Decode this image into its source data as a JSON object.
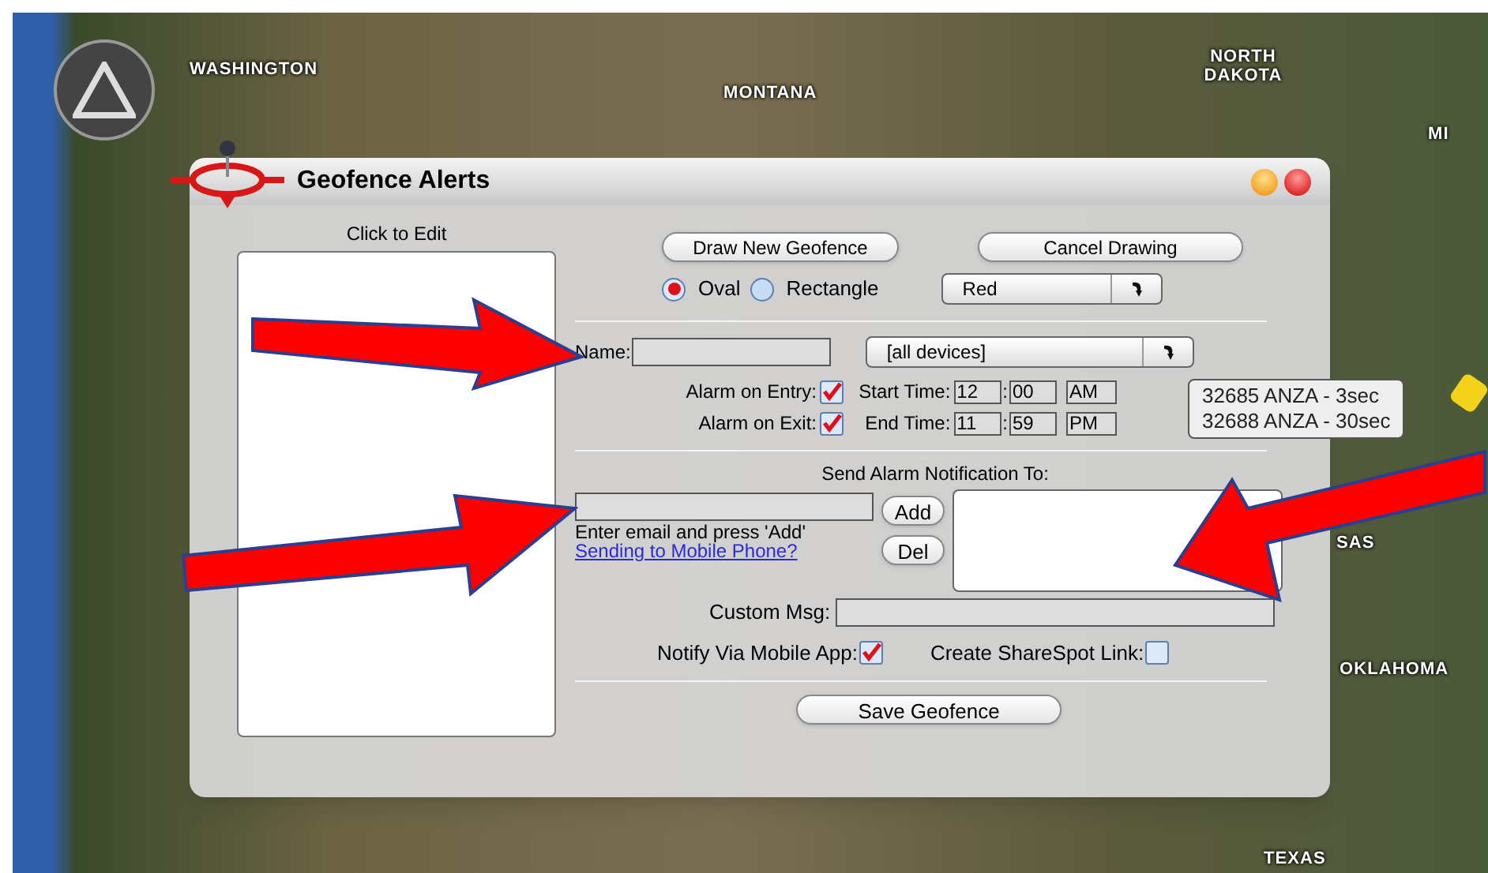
{
  "map": {
    "labels": [
      "WASHINGTON",
      "MONTANA",
      "NORTH DAKOTA",
      "MI",
      "SAS",
      "OKLAHOMA",
      "TEXAS"
    ],
    "tooltip_lines": [
      "32685 ANZA - 3sec",
      "32688 ANZA - 30sec"
    ]
  },
  "dialog": {
    "title": "Geofence Alerts",
    "list_header": "Click to Edit",
    "draw_button": "Draw New Geofence",
    "cancel_button": "Cancel Drawing",
    "shapes": [
      {
        "label": "Oval",
        "selected": true
      },
      {
        "label": "Rectangle",
        "selected": false
      }
    ],
    "color_select": "Red",
    "name_label": "Name:",
    "device_select": "[all devices]",
    "alarms": [
      {
        "label": "Alarm on Entry:",
        "checked": true
      },
      {
        "label": "Alarm on Exit:",
        "checked": true
      }
    ],
    "times": [
      {
        "label": "Start Time:",
        "hour": "12",
        "separator": ":",
        "minute": "00",
        "ampm": "AM"
      },
      {
        "label": "End Time:",
        "hour": "11",
        "separator": ":",
        "minute": "59",
        "ampm": "PM"
      }
    ],
    "notify_heading": "Send Alarm Notification To:",
    "email_hint": "Enter email and press 'Add'",
    "mobile_link": "Sending to Mobile Phone?",
    "add_button": "Add",
    "del_button": "Del",
    "custom_msg_label": "Custom Msg:",
    "options": [
      {
        "label": "Notify Via Mobile App:",
        "checked": true
      },
      {
        "label": "Create ShareSpot Link:",
        "checked": false
      }
    ],
    "save_button": "Save Geofence"
  }
}
